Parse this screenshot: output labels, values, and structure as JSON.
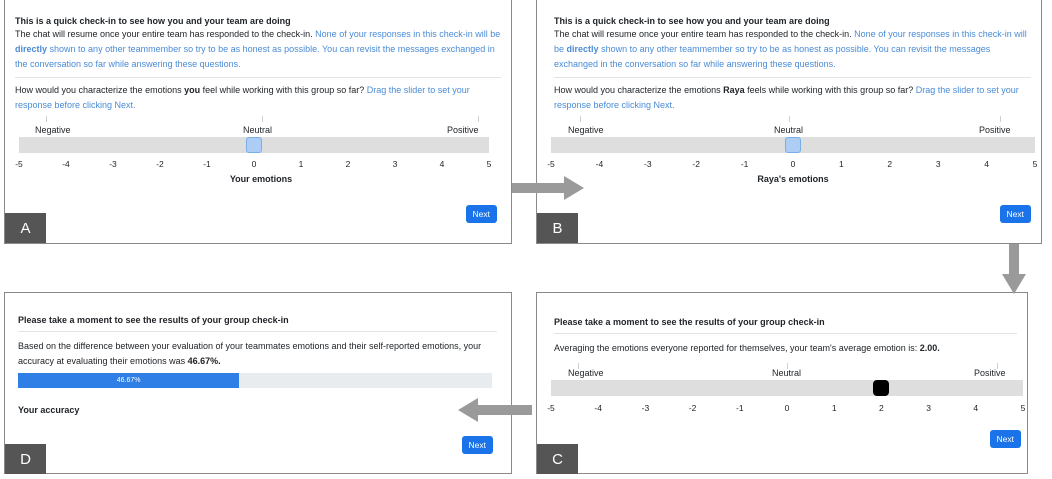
{
  "checkin": {
    "title": "This is a quick check-in to see how you and your team are doing",
    "intro_black": "The chat will resume once your entire team has responded to the check-in.",
    "intro_blue_1": "None of your responses in this check-in will be",
    "intro_bold": "directly",
    "intro_blue_2": "shown to any other teammember so try to be as honest as possible. You can revisit the messages exchanged in the conversation so far while answering these questions.",
    "question_pre": "How would you characterize the emotions",
    "question_post_self": "feel while working with this group so far?",
    "question_post_other": "feels while working with this group so far?",
    "question_hint": "Drag the slider to set your response before clicking Next."
  },
  "scale": {
    "negative": "Negative",
    "neutral": "Neutral",
    "positive": "Positive",
    "ticks": [
      "-5",
      "-4",
      "-3",
      "-2",
      "-1",
      "0",
      "1",
      "2",
      "3",
      "4",
      "5"
    ]
  },
  "panel_a": {
    "letter": "A",
    "subject": "you",
    "slider_value": 0,
    "caption": "Your emotions",
    "next": "Next"
  },
  "panel_b": {
    "letter": "B",
    "subject": "Raya",
    "slider_value": 0,
    "caption": "Raya's emotions",
    "next": "Next"
  },
  "results": {
    "title": "Please take a moment to see the results of your group check-in"
  },
  "panel_c": {
    "letter": "C",
    "text_pre": "Averaging the emotions everyone reported for themselves, your team's average emotion is:",
    "text_value": "2.00.",
    "slider_value": 2,
    "next": "Next"
  },
  "panel_d": {
    "letter": "D",
    "text_pre": "Based on the difference between your evaluation of your teammates emotions and their self-reported emotions, your accuracy at evaluating their emotions was",
    "text_value": "46.67%.",
    "progress_label": "46.67%",
    "progress_fraction": 0.4667,
    "caption": "Your accuracy",
    "next": "Next"
  },
  "colors": {
    "accent_blue": "#1a73e8",
    "hint_blue": "#4a8bd6",
    "arrow_gray": "#9a9a9a",
    "letter_bg": "#555555"
  }
}
